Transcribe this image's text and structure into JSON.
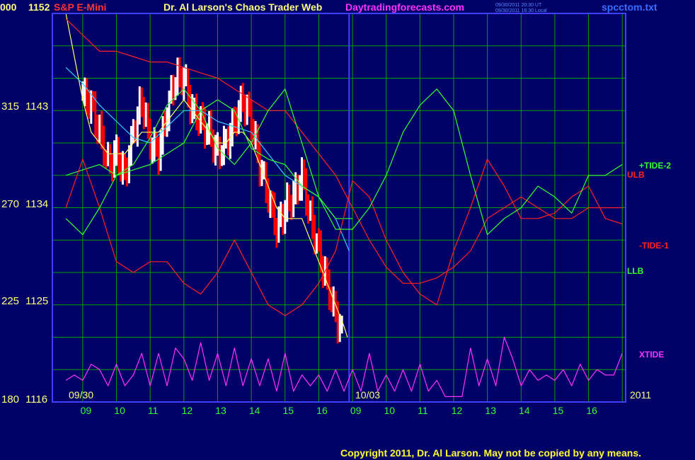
{
  "header": {
    "left_code": "000",
    "left_code_color": "#ffff80",
    "symbol": "S&P E-Mini",
    "symbol_color": "#ff3333",
    "title": "Dr. Al Larson's Chaos Trader Web",
    "title_color": "#ffff80",
    "site": "Daytradingforecasts.com",
    "site_color": "#ff33ff",
    "timestamp_ut": "09/30/2011 20:30 UT",
    "timestamp_local": "09/30/2011 16:30 Local",
    "filename": "spcctom.txt",
    "filename_color": "#3b6dff"
  },
  "footer": {
    "copyright": "Copyright 2011, Dr. Al Larson. May not be copied by any means.",
    "copyright_color": "#ffff33"
  },
  "chart_data": {
    "type": "line",
    "xlabel": "",
    "ylabel": "",
    "ylim": [
      1116,
      1152
    ],
    "grid": true,
    "y_ticks": [
      {
        "left": "180",
        "price": "1116",
        "value": 1116
      },
      {
        "left": "225",
        "price": "1125",
        "value": 1125
      },
      {
        "left": "270",
        "price": "1134",
        "value": 1134
      },
      {
        "left": "315",
        "price": "1143",
        "value": 1143
      },
      {
        "left": "000",
        "price": "1152",
        "value": 1152
      }
    ],
    "x_ticks": [
      "09",
      "10",
      "11",
      "12",
      "13",
      "14",
      "15",
      "16",
      "09",
      "10",
      "11",
      "12",
      "13",
      "14",
      "15",
      "16"
    ],
    "date_labels": {
      "first": "09/30",
      "second": "10/03",
      "year": "2011"
    },
    "series_labels": [
      {
        "text": "+TIDE-2",
        "color": "#33ff33"
      },
      {
        "text": "ULB",
        "color": "#ff2222"
      },
      {
        "text": "-TIDE-1",
        "color": "#ff2222"
      },
      {
        "text": "LLB",
        "color": "#33ff33"
      },
      {
        "text": "XTIDE",
        "color": "#ff33ff"
      }
    ],
    "colors": {
      "grid": "#00a000",
      "frame": "#4040ff",
      "up_bar": "#ffffff",
      "down_bar": "#ff0000",
      "avg_fast": "#ffff66",
      "avg_slow": "#33ccff",
      "green": "#33ff33",
      "red": "#ff2222",
      "xtide": "#ff33ff"
    },
    "series": [
      {
        "key": "price_close",
        "x": [
          0,
          0.25,
          0.5,
          0.75,
          1,
          1.25,
          1.5,
          1.75,
          2,
          2.25,
          2.5,
          2.75,
          3,
          3.25,
          3.5,
          3.75,
          4,
          4.25,
          4.5,
          4.75,
          5,
          5.25,
          5.5,
          5.75,
          6,
          6.25,
          6.5,
          6.75,
          7,
          7.25,
          7.5,
          7.75
        ],
        "y": [
          1144.5,
          1143.5,
          1141,
          1138,
          1139,
          1137,
          1141,
          1144,
          1140,
          1139,
          1143,
          1146,
          1146,
          1143,
          1142,
          1141,
          1139,
          1140,
          1142,
          1144,
          1142,
          1138,
          1135,
          1132,
          1134,
          1135,
          1137,
          1133,
          1130,
          1127,
          1124,
          1122
        ]
      },
      {
        "key": "avg_fast",
        "x": [
          -0.5,
          -0.25,
          0,
          0.25,
          0.5,
          0.75,
          1,
          1.25,
          1.5,
          1.75,
          2,
          2.25,
          2.5,
          2.75,
          3,
          3.25,
          3.5,
          3.75,
          4,
          4.25,
          4.5,
          4.75,
          5,
          5.25,
          5.5,
          5.75,
          6,
          6.25,
          6.5,
          6.75,
          7,
          7.25,
          7.5,
          7.75,
          7.85
        ],
        "y": [
          1152,
          1148,
          1144,
          1141,
          1140,
          1139,
          1139,
          1139,
          1140,
          1141,
          1141,
          1141,
          1142,
          1143,
          1144,
          1143,
          1142,
          1141,
          1140,
          1140,
          1141,
          1141,
          1140,
          1138,
          1136,
          1134,
          1133,
          1133,
          1133,
          1131,
          1129,
          1127,
          1125,
          1123,
          1122
        ]
      },
      {
        "key": "avg_slow",
        "x": [
          -0.5,
          0,
          0.5,
          1,
          1.5,
          2,
          2.5,
          3,
          3.5,
          4,
          4.5,
          5,
          5.5,
          6,
          6.5,
          7,
          7.5,
          7.9
        ],
        "y": [
          1147,
          1145.5,
          1143.5,
          1142,
          1140.5,
          1140,
          1141.5,
          1143,
          1143,
          1142,
          1141.5,
          1141,
          1139,
          1137,
          1136,
          1135,
          1133,
          1130
        ]
      },
      {
        "key": "green_band",
        "x": [
          -0.5,
          0,
          0.5,
          1,
          1.5,
          2,
          2.5,
          3,
          3.5,
          4,
          4.5,
          5,
          5.5,
          6,
          6.5,
          7,
          7.5,
          8
        ],
        "y": [
          1137,
          1137.5,
          1138,
          1137,
          1137.5,
          1138,
          1139,
          1140,
          1143,
          1144,
          1143,
          1139.5,
          1138.5,
          1138,
          1136,
          1135,
          1133,
          1133
        ]
      },
      {
        "key": "ulb",
        "x": [
          -0.5,
          0,
          0.5,
          1,
          1.5,
          2,
          2.5,
          3,
          3.5,
          4,
          4.5,
          5,
          5.5,
          6,
          6.5,
          7,
          7.5,
          8,
          8.5,
          9,
          9.5,
          10,
          10.5,
          11,
          11.5,
          12,
          12.5,
          13,
          13.5,
          14,
          14.5,
          15,
          15.5,
          16
        ],
        "y": [
          1151.5,
          1150,
          1148.5,
          1148.5,
          1148,
          1147.5,
          1147.5,
          1147,
          1146.5,
          1146,
          1145,
          1144,
          1143,
          1143,
          1141,
          1139,
          1137,
          1134,
          1131,
          1128.5,
          1127,
          1127,
          1127.5,
          1128.5,
          1130,
          1133,
          1134,
          1135,
          1134,
          1133,
          1133,
          1134,
          1134,
          1134
        ]
      },
      {
        "key": "minus_tide",
        "x": [
          -0.5,
          0,
          0.5,
          1,
          1.5,
          2,
          2.5,
          3,
          3.5,
          4,
          4.5,
          5,
          5.5,
          6,
          6.5,
          7,
          7.5,
          8,
          8.5,
          9,
          9.5,
          10,
          10.5,
          11,
          11.5,
          12,
          12.5,
          13,
          13.5,
          14,
          14.5,
          15,
          15.5,
          16
        ],
        "y": [
          1134,
          1138.5,
          1134,
          1129,
          1128,
          1129,
          1129,
          1127,
          1126,
          1128,
          1131,
          1128,
          1125,
          1124,
          1125,
          1127,
          1130,
          1136.5,
          1135,
          1131,
          1128,
          1126,
          1125,
          1130,
          1134,
          1138.5,
          1136,
          1133,
          1133,
          1133.5,
          1135,
          1136,
          1133,
          1132.5
        ]
      },
      {
        "key": "plus_tide",
        "x": [
          -0.5,
          0,
          0.5,
          1,
          1.5,
          2,
          2.5,
          3,
          3.5,
          4,
          4.5,
          5,
          5.5,
          6,
          6.5,
          7,
          7.5,
          8,
          8.5,
          9,
          9.5,
          10,
          10.5,
          11,
          11.5,
          12,
          12.5,
          13,
          13.5,
          14,
          14.5,
          15,
          15.5,
          16
        ],
        "y": [
          1133,
          1131.5,
          1134,
          1137,
          1138,
          1140.5,
          1143.5,
          1145,
          1143,
          1139.5,
          1138,
          1140,
          1143,
          1145,
          1140,
          1135,
          1132,
          1132,
          1134,
          1137,
          1141,
          1143.5,
          1145,
          1143,
          1137,
          1131.5,
          1133,
          1134,
          1136,
          1135,
          1133.5,
          1137,
          1137,
          1138
        ]
      },
      {
        "key": "xtide",
        "x": [
          -0.5,
          -0.25,
          0,
          0.25,
          0.5,
          0.75,
          1,
          1.25,
          1.5,
          1.75,
          2,
          2.25,
          2.5,
          2.75,
          3,
          3.25,
          3.5,
          3.75,
          4,
          4.25,
          4.5,
          4.75,
          5,
          5.25,
          5.5,
          5.75,
          6,
          6.25,
          6.5,
          6.75,
          7,
          7.25,
          7.5,
          7.75,
          8,
          8.25,
          8.5,
          8.75,
          9,
          9.25,
          9.5,
          9.75,
          10,
          10.25,
          10.5,
          10.75,
          11,
          11.25,
          11.5,
          11.75,
          12,
          12.25,
          12.5,
          12.75,
          13,
          13.25,
          13.5,
          13.75,
          14,
          14.25,
          14.5,
          14.75,
          15,
          15.25,
          15.5,
          15.75,
          16
        ],
        "y": [
          1118,
          1118.5,
          1118,
          1119.5,
          1119,
          1117.5,
          1119.5,
          1117.5,
          1118.5,
          1120.5,
          1117.5,
          1120.5,
          1117.5,
          1121,
          1120,
          1118,
          1121.5,
          1118,
          1120.5,
          1117.5,
          1121,
          1117.5,
          1120,
          1117.5,
          1120,
          1117,
          1120.5,
          1117,
          1118.5,
          1117.5,
          1118.5,
          1117,
          1119,
          1117,
          1119,
          1117,
          1120.5,
          1117,
          1118.5,
          1117,
          1119,
          1117,
          1119.5,
          1117,
          1118,
          1116.5,
          1116.5,
          1116.5,
          1121,
          1117.5,
          1120,
          1117.5,
          1122,
          1120,
          1117.5,
          1119,
          1118,
          1118.5,
          1118,
          1119,
          1117.5,
          1119.5,
          1118,
          1119,
          1118.5,
          1118.5,
          1120.5
        ]
      }
    ]
  }
}
